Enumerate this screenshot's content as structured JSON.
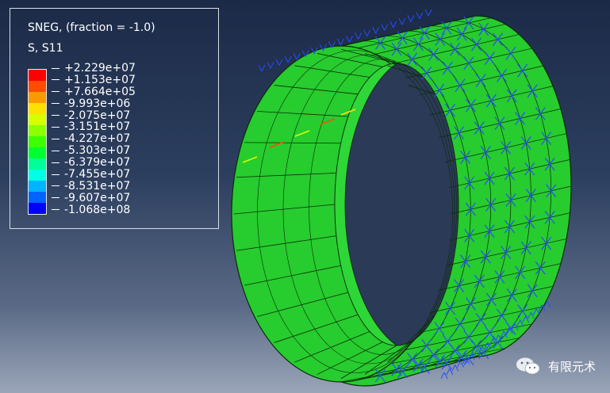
{
  "legend": {
    "title": "SNEG, (fraction = -1.0)",
    "subtitle": "S, S11",
    "entries": [
      {
        "label": "+2.229e+07",
        "color": "#ff0000"
      },
      {
        "label": "+1.153e+07",
        "color": "#ff4c00"
      },
      {
        "label": "+7.664e+05",
        "color": "#ff9900"
      },
      {
        "label": "-9.993e+06",
        "color": "#ffe100"
      },
      {
        "label": "-2.075e+07",
        "color": "#d6ff00"
      },
      {
        "label": "-3.151e+07",
        "color": "#8cff00"
      },
      {
        "label": "-4.227e+07",
        "color": "#3cff00"
      },
      {
        "label": "-5.303e+07",
        "color": "#00ff2e"
      },
      {
        "label": "-6.379e+07",
        "color": "#00ff9a"
      },
      {
        "label": "-7.455e+07",
        "color": "#00ffe6"
      },
      {
        "label": "-8.531e+07",
        "color": "#00b4ff"
      },
      {
        "label": "-9.607e+07",
        "color": "#0064ff"
      },
      {
        "label": "-1.068e+08",
        "color": "#0000ff"
      }
    ],
    "tick_count": 14
  },
  "model": {
    "type": "cylindrical-shell-contour",
    "shell_color": "#27cc2e",
    "mesh_color": "#0b2a0b",
    "load_arrow_color": "#2a4dff"
  },
  "watermark": {
    "text": "有限元术"
  }
}
